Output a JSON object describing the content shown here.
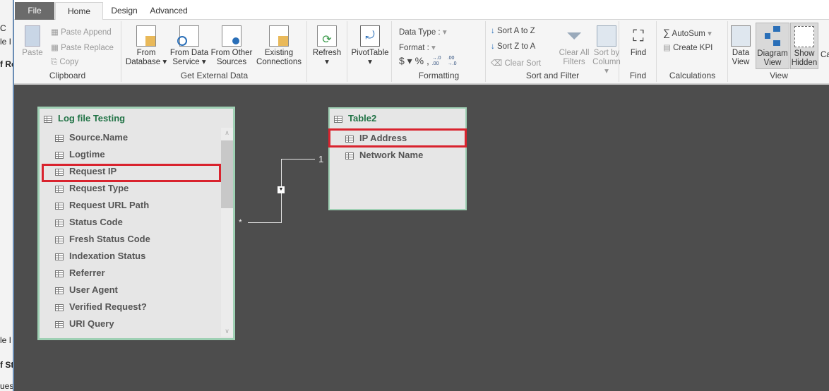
{
  "background_window": {
    "fragments": [
      "C",
      "le I",
      "f Re",
      "le I",
      "f Sta",
      "ues"
    ]
  },
  "tabs": [
    "File",
    "Home",
    "Design",
    "Advanced"
  ],
  "active_tab": "Home",
  "ribbon": {
    "clipboard": {
      "label": "Clipboard",
      "paste": "Paste",
      "paste_append": "Paste Append",
      "paste_replace": "Paste Replace",
      "copy": "Copy"
    },
    "external": {
      "label": "Get External Data",
      "from_database": [
        "From",
        "Database"
      ],
      "from_data_service": [
        "From Data",
        "Service"
      ],
      "from_other": [
        "From Other",
        "Sources"
      ],
      "existing": [
        "Existing",
        "Connections"
      ]
    },
    "refresh": "Refresh",
    "pivot": "PivotTable",
    "formatting": {
      "label": "Formatting",
      "data_type": "Data Type :",
      "format": "Format :",
      "currency": "$",
      "percent": "%",
      "comma": "9",
      "inc": "→.0 .00",
      "dec": ".00 →.0"
    },
    "sort": {
      "label": "Sort and Filter",
      "az": "Sort A to Z",
      "za": "Sort Z to A",
      "clear": "Clear Sort",
      "clear_filters": [
        "Clear All",
        "Filters"
      ],
      "sort_by_column": [
        "Sort by",
        "Column"
      ]
    },
    "find": {
      "label": "Find",
      "find": "Find"
    },
    "calc": {
      "label": "Calculations",
      "autosum": "AutoSum",
      "kpi": "Create KPI"
    },
    "view": {
      "label": "View",
      "data_view": [
        "Data",
        "View"
      ],
      "diagram_view": [
        "Diagram",
        "View"
      ],
      "show_hidden": [
        "Show",
        "Hidden"
      ],
      "cut": "Ca"
    }
  },
  "diagram": {
    "table1": {
      "title": "Log file Testing",
      "columns": [
        "Source.Name",
        "Logtime",
        "Request IP",
        "Request Type",
        "Request URL Path",
        "Status Code",
        "Fresh Status Code",
        "Indexation Status",
        "Referrer",
        "User Agent",
        "Verified Request?",
        "URI Query"
      ],
      "highlighted": "Request IP"
    },
    "table2": {
      "title": "Table2",
      "columns": [
        "IP Address",
        "Network Name"
      ],
      "highlighted": "IP Address"
    },
    "relationship": {
      "many": "*",
      "one": "1"
    }
  },
  "colors": {
    "accent": "#217346",
    "highlight": "#d9232e",
    "canvas": "#4d4d4d",
    "table_border": "#9fd0b4"
  }
}
